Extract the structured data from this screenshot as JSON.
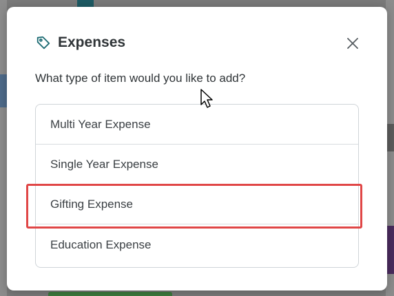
{
  "modal": {
    "title": "Expenses",
    "question": "What type of item would you like to add?",
    "title_icon": "tag-icon",
    "close_icon": "close-icon"
  },
  "options": [
    {
      "label": "Multi Year Expense"
    },
    {
      "label": "Single Year Expense"
    },
    {
      "label": "Gifting Expense",
      "highlighted": true
    },
    {
      "label": "Education Expense"
    }
  ],
  "colors": {
    "overlay": "#7a7a7a",
    "modal_bg": "#ffffff",
    "title_text": "#2f3437",
    "option_text": "#3a3f43",
    "border": "#cfd4d8",
    "highlight": "#e04646",
    "icon_teal": "#1c6b73"
  }
}
